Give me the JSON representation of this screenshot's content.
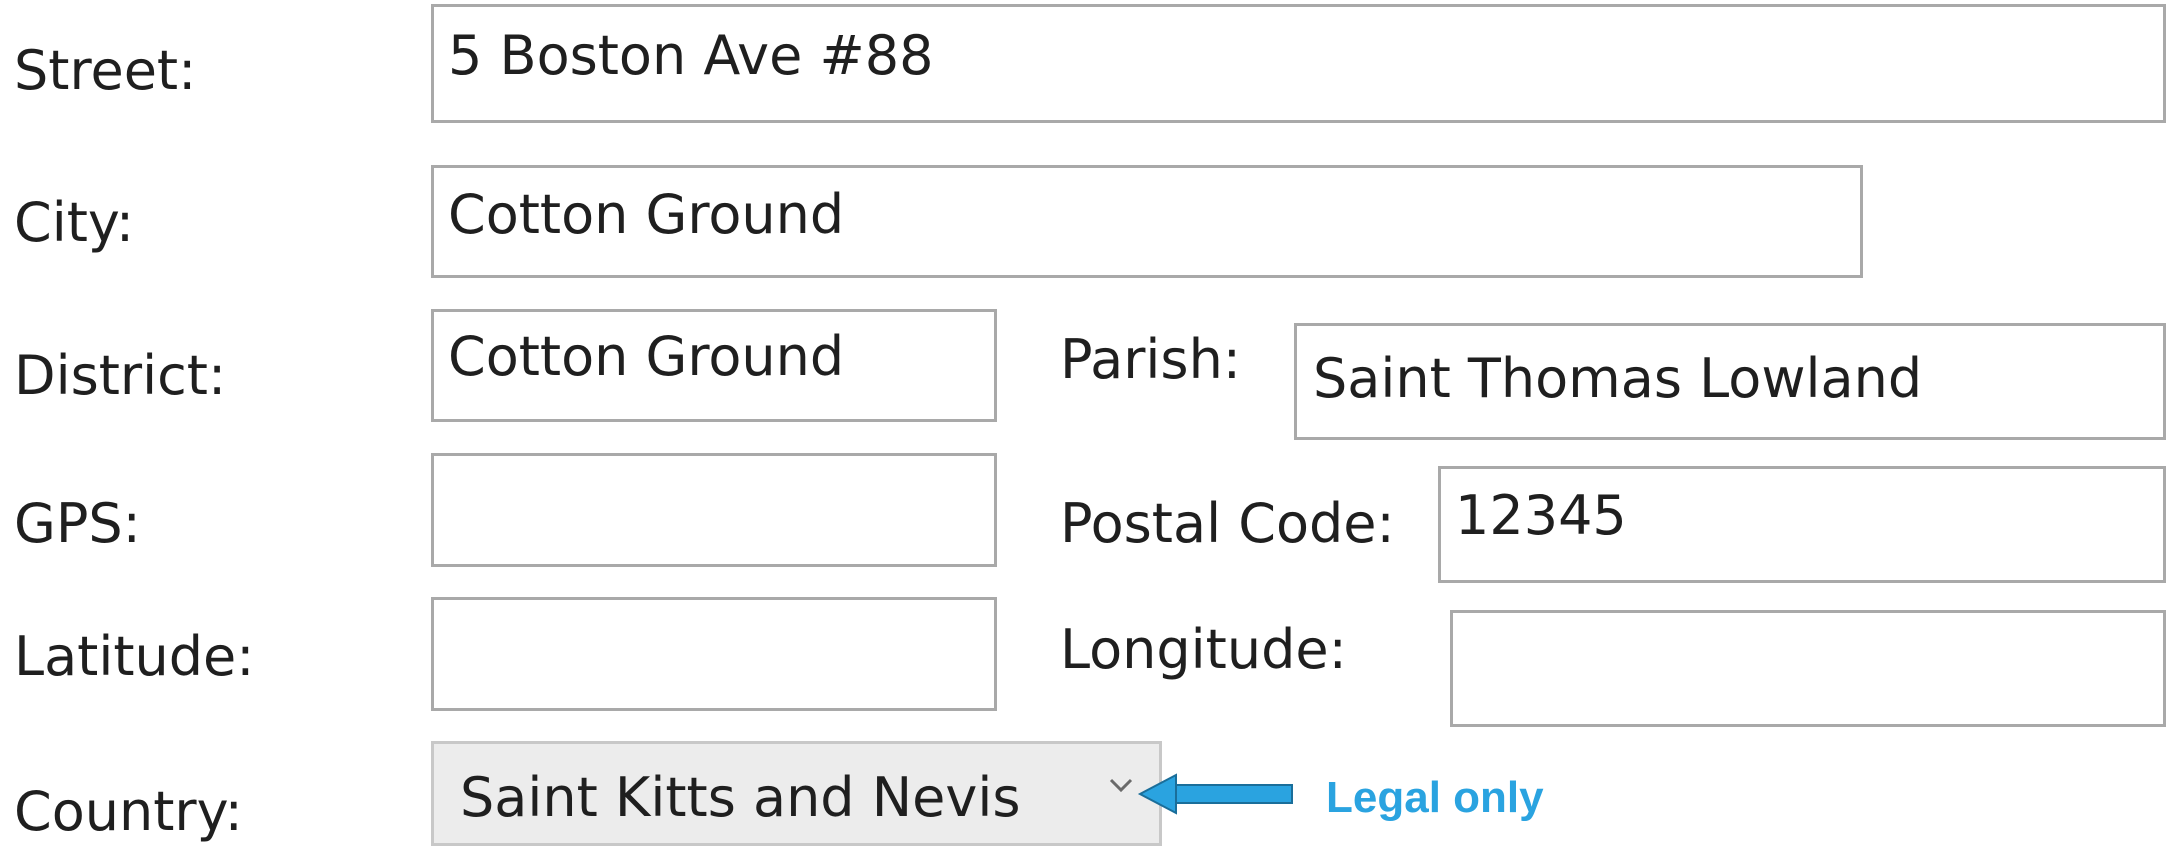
{
  "form": {
    "street": {
      "label": "Street:",
      "value": "5 Boston Ave #88"
    },
    "city": {
      "label": "City:",
      "value": "Cotton Ground"
    },
    "district": {
      "label": "District:",
      "value": "Cotton Ground"
    },
    "parish": {
      "label": "Parish:",
      "value": "Saint Thomas Lowland"
    },
    "gps": {
      "label": "GPS:",
      "value": ""
    },
    "postal_code": {
      "label": "Postal Code:",
      "value": "12345"
    },
    "latitude": {
      "label": "Latitude:",
      "value": ""
    },
    "longitude": {
      "label": "Longitude:",
      "value": ""
    },
    "country": {
      "label": "Country:",
      "value": "Saint Kitts and Nevis"
    }
  },
  "annotation": {
    "text": "Legal only",
    "color": "#2aa3e0",
    "icon": "arrow-left-icon"
  },
  "colors": {
    "field_border": "#a9a9a9",
    "select_background": "#ececec"
  }
}
